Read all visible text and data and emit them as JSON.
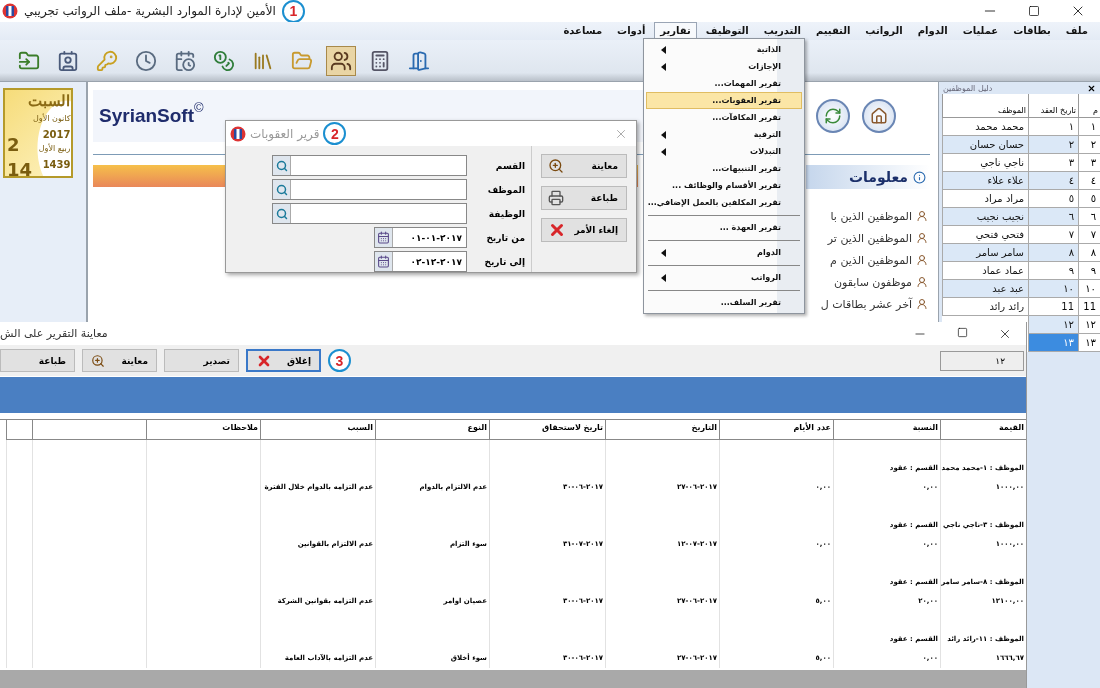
{
  "main_window": {
    "title": "الأمين لإدارة الموارد البشرية -ملف الرواتب تجريبي",
    "callout": "1"
  },
  "menu_bar": [
    {
      "label": "ملف",
      "selected": false
    },
    {
      "label": "بطاقات",
      "selected": false
    },
    {
      "label": "عمليات",
      "selected": false
    },
    {
      "label": "الدوام",
      "selected": false
    },
    {
      "label": "الرواتب",
      "selected": false
    },
    {
      "label": "التقييم",
      "selected": false
    },
    {
      "label": "التدريب",
      "selected": false
    },
    {
      "label": "التوظيف",
      "selected": false
    },
    {
      "label": "تقارير",
      "selected": true
    },
    {
      "label": "أدوات",
      "selected": false
    },
    {
      "label": "مساعدة",
      "selected": false
    }
  ],
  "toolbar": [
    {
      "kind": "import",
      "selected": false
    },
    {
      "kind": "contact",
      "selected": false
    },
    {
      "kind": "key",
      "selected": false
    },
    {
      "kind": "clock",
      "selected": false
    },
    {
      "kind": "schedule",
      "selected": false
    },
    {
      "kind": "coins",
      "selected": false
    },
    {
      "kind": "books",
      "selected": false
    },
    {
      "kind": "folder",
      "selected": false
    },
    {
      "kind": "users",
      "selected": true
    },
    {
      "kind": "calculator",
      "selected": false
    },
    {
      "kind": "exit",
      "selected": false
    }
  ],
  "calendar": {
    "weekday": "السبت",
    "month": "كانون الأول",
    "year": "2017",
    "day": "2",
    "hijri_month": "ربيع الأول",
    "hijri_year": "1439",
    "hijri_day": "14"
  },
  "brand": {
    "name": "SyrianSoft",
    "mark": "©"
  },
  "info_panel": {
    "title": "معلومات",
    "items": [
      "الموظفين الذين با",
      "الموظفين الذين تر",
      "الموظفين الذين م",
      "موظفون سابقون",
      "آخر عشر بطاقات ل"
    ]
  },
  "employee_list": {
    "title": "دليل الموظفين",
    "columns": [
      "م",
      "تاريخ العقد",
      "الموظف"
    ],
    "rows": [
      {
        "number": "١",
        "contract": "١",
        "name": "محمد محمد",
        "selected": false
      },
      {
        "number": "٢",
        "contract": "٢",
        "name": "حسان حسان",
        "selected": false
      },
      {
        "number": "٣",
        "contract": "٣",
        "name": "ناجي ناجي",
        "selected": false
      },
      {
        "number": "٤",
        "contract": "٤",
        "name": "علاء علاء",
        "selected": false
      },
      {
        "number": "٥",
        "contract": "٥",
        "name": "مراد مراد",
        "selected": false
      },
      {
        "number": "٦",
        "contract": "٦",
        "name": "نجيب نجيب",
        "selected": false
      },
      {
        "number": "٧",
        "contract": "٧",
        "name": "فتحي فتحي",
        "selected": false
      },
      {
        "number": "٨",
        "contract": "٨",
        "name": "سامر سامر",
        "selected": false
      },
      {
        "number": "٩",
        "contract": "٩",
        "name": "عماد عماد",
        "selected": false
      },
      {
        "number": "١٠",
        "contract": "١٠",
        "name": "عبد عبد",
        "selected": false
      },
      {
        "number": "11",
        "contract": "11",
        "name": "رائد رائد",
        "selected": false
      },
      {
        "number": "١٢",
        "contract": "١٢",
        "selected": false
      },
      {
        "number": "١٣",
        "contract": "١٣",
        "selected": true
      }
    ]
  },
  "reports_menu": [
    {
      "kind": "submenu",
      "label": "الذاتية",
      "selected": false
    },
    {
      "kind": "submenu",
      "label": "الإجازات",
      "selected": false
    },
    {
      "kind": "item",
      "label": "تقرير المهمات...",
      "selected": false
    },
    {
      "kind": "item",
      "label": "تقرير العقوبات...",
      "selected": true
    },
    {
      "kind": "item",
      "label": "تقرير المكافآت...",
      "selected": false
    },
    {
      "kind": "submenu",
      "label": "الترقية",
      "selected": false
    },
    {
      "kind": "submenu",
      "label": "التبدلات",
      "selected": false
    },
    {
      "kind": "item",
      "label": "تقرير التنبيهات...",
      "selected": false
    },
    {
      "kind": "item",
      "label": "تقرير الأقسام والوظائف ...",
      "selected": false
    },
    {
      "kind": "item",
      "label": "تقرير المكلفين بالعمل الإضافي...",
      "selected": false
    },
    {
      "kind": "separator"
    },
    {
      "kind": "item",
      "label": "تقرير العهدة ...",
      "selected": false
    },
    {
      "kind": "separator"
    },
    {
      "kind": "submenu",
      "label": "الدوام",
      "selected": false
    },
    {
      "kind": "separator"
    },
    {
      "kind": "submenu",
      "label": "الرواتب",
      "selected": false
    },
    {
      "kind": "separator"
    },
    {
      "kind": "item",
      "label": "تقرير السلف...",
      "selected": false
    }
  ],
  "penalties_dialog": {
    "title": "قرير العقوبات",
    "callout": "2",
    "fields": [
      {
        "kind": "lookup",
        "label": "القسم"
      },
      {
        "kind": "lookup",
        "label": "الموظف"
      },
      {
        "kind": "lookup",
        "label": "الوظيفة"
      },
      {
        "kind": "date",
        "label": "من تاريخ",
        "value": "٢٠١٧-٠١-٠١"
      },
      {
        "kind": "date",
        "label": "إلى تاريخ",
        "value": "٢٠١٧-١٢-٠٢"
      }
    ],
    "buttons": [
      {
        "kind": "preview",
        "label": "معاينة"
      },
      {
        "kind": "print",
        "label": "طباعة"
      },
      {
        "kind": "cancel",
        "label": "إلغاء الأمر"
      }
    ]
  },
  "report_preview": {
    "title": "معاينة التقرير على الش",
    "callout": "3",
    "buttons": [
      {
        "kind": "close",
        "label": "إغلاق",
        "focused": true
      },
      {
        "kind": "export",
        "label": "تصدير",
        "focused": false
      },
      {
        "kind": "preview",
        "label": "معاينة",
        "focused": false
      },
      {
        "kind": "print",
        "label": "طباعة",
        "focused": false
      }
    ],
    "page": "١٢",
    "columns": [
      "القيمة",
      "النسبة",
      "عدد الأيام",
      "التاريخ",
      "تاريخ لاستحقاق",
      "النوع",
      "السبب",
      "ملاحظات"
    ],
    "groups": [
      {
        "employee": "الموظف : ١-محمد محمد",
        "department": "القسم : عقود",
        "cells": [
          "١٠٠٠,٠٠",
          "٠,٠٠",
          "٠,٠٠",
          "٢٠١٧-٠٦-٢٧",
          "٢٠١٧-٠٦-٣٠",
          "عدم الالتزام بالدوام",
          "عدم التزامه بالدوام خلال الفترة"
        ]
      },
      {
        "employee": "الموظف : ٣-ناجي ناجي",
        "department": "القسم : عقود",
        "cells": [
          "١٠٠٠,٠٠",
          "٠,٠٠",
          "٠,٠٠",
          "٢٠١٧-٠٧-١٢",
          "٢٠١٧-٠٧-٣١",
          "سوء التزام",
          "عدم الالتزام بالقوانين"
        ]
      },
      {
        "employee": "الموظف : ٨-سامر سامر",
        "department": "القسم : عقود",
        "cells": [
          "١٢١٠٠,٠٠",
          "٢٠,٠٠",
          "٥,٠٠",
          "٢٠١٧-٠٦-٢٧",
          "٢٠١٧-٠٦-٣٠",
          "عصيان اوامر",
          "عدم التزامه بقوانين الشركة"
        ]
      },
      {
        "employee": "الموظف : ١١-رائد رائد",
        "department": "القسم : عقود",
        "cells": [
          "١٦٦٦,٦٧",
          "٠,٠٠",
          "٥,٠٠",
          "٢٠١٧-٠٦-٢٧",
          "٢٠١٧-٠٦-٣٠",
          "سوء أخلاق",
          "عدم التزامه بالآداب العامة"
        ]
      }
    ]
  }
}
